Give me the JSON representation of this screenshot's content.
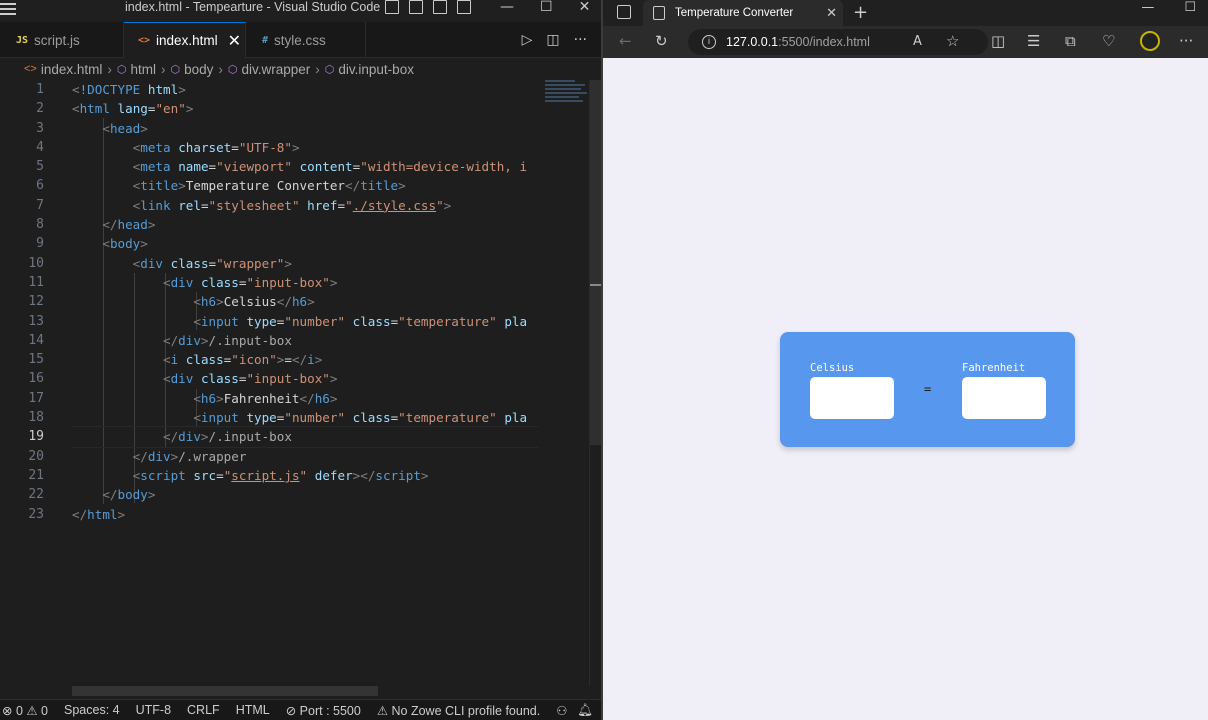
{
  "vscode": {
    "window_title": "index.html - Tempearture - Visual Studio Code",
    "tabs": [
      {
        "icon": "JS",
        "label": "script.js"
      },
      {
        "icon": "<>",
        "label": "index.html",
        "close": "✕"
      },
      {
        "icon": "#",
        "label": "style.css"
      }
    ],
    "breadcrumb": [
      "index.html",
      "html",
      "body",
      "div.wrapper",
      "div.input-box"
    ],
    "current_line": 19,
    "line_numbers": [
      "1",
      "2",
      "3",
      "4",
      "5",
      "6",
      "7",
      "8",
      "9",
      "10",
      "11",
      "12",
      "13",
      "14",
      "15",
      "16",
      "17",
      "18",
      "19",
      "20",
      "21",
      "22",
      "23"
    ],
    "status": {
      "problems": "⊗ 0 ⚠ 0",
      "spaces": "Spaces: 4",
      "encoding": "UTF-8",
      "eol": "CRLF",
      "language": "HTML",
      "port": "⊘ Port : 5500",
      "zowe": "⚠ No Zowe CLI profile found."
    }
  },
  "browser": {
    "tab_title": "Temperature Converter",
    "url_host": "127.0.0.1",
    "url_path": ":5500/index.html",
    "page": {
      "celsius_label": "Celsius",
      "fahrenheit_label": "Fahrenheit",
      "equals": "=",
      "celsius_value": "",
      "fahrenheit_value": ""
    },
    "colors": {
      "card": "#5897ee",
      "background": "#f0eff7"
    }
  }
}
